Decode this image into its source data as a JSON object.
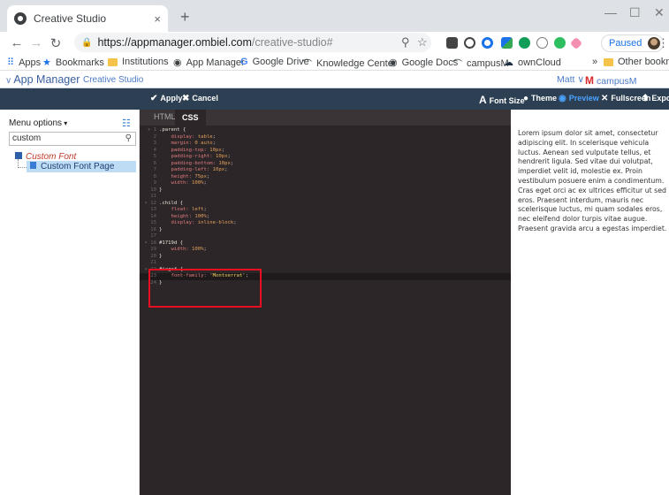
{
  "browser": {
    "tab_title": "Creative Studio",
    "tab_close": "×",
    "new_tab": "+",
    "url_host": "https://appmanager.ombiel.com",
    "url_path": "/creative-studio#",
    "paused_label": "Paused",
    "bookmarks": [
      {
        "label": "Apps"
      },
      {
        "label": "Bookmarks"
      },
      {
        "label": "Institutions"
      },
      {
        "label": "App Manager"
      },
      {
        "label": "Google Drive"
      },
      {
        "label": "Knowledge Center"
      },
      {
        "label": "Google Docs"
      },
      {
        "label": "campusM"
      },
      {
        "label": "ownCloud"
      }
    ],
    "more_bookmarks": "»",
    "other_bookmarks": "Other bookmarks"
  },
  "app": {
    "title": "App Manager",
    "subtitle": "Creative Studio",
    "user": "Matt",
    "org": "campusM University"
  },
  "toolbar": {
    "apply": "Apply",
    "cancel": "Cancel",
    "font_size": "Font Size",
    "theme": "Theme",
    "preview": "Preview",
    "fullscreen": "Fullscreen",
    "export": "Export"
  },
  "sidebar": {
    "menu_options": "Menu options",
    "search_value": "custom",
    "tree_root": "Custom Font",
    "tree_child": "Custom Font Page"
  },
  "editor": {
    "tabs": [
      "HTML",
      "CSS"
    ],
    "active_tab": "CSS"
  },
  "code_lines": [
    {
      "n": "1",
      "parts": [
        [
          "sel",
          ".parent {"
        ]
      ],
      "fold": true
    },
    {
      "n": "2",
      "parts": [
        [
          "prop",
          "    display: "
        ],
        [
          "val",
          "table"
        ],
        [
          "punc",
          ";"
        ]
      ]
    },
    {
      "n": "3",
      "parts": [
        [
          "prop",
          "    margin: "
        ],
        [
          "val",
          "0 auto"
        ],
        [
          "punc",
          ";"
        ]
      ]
    },
    {
      "n": "4",
      "parts": [
        [
          "prop",
          "    padding-top: "
        ],
        [
          "val",
          "10px"
        ],
        [
          "punc",
          ";"
        ]
      ]
    },
    {
      "n": "5",
      "parts": [
        [
          "prop",
          "    padding-right: "
        ],
        [
          "val",
          "10px"
        ],
        [
          "punc",
          ";"
        ]
      ]
    },
    {
      "n": "6",
      "parts": [
        [
          "prop",
          "    padding-bottom: "
        ],
        [
          "val",
          "10px"
        ],
        [
          "punc",
          ";"
        ]
      ]
    },
    {
      "n": "7",
      "parts": [
        [
          "prop",
          "    padding-left: "
        ],
        [
          "val",
          "10px"
        ],
        [
          "punc",
          ";"
        ]
      ]
    },
    {
      "n": "8",
      "parts": [
        [
          "prop",
          "    height: "
        ],
        [
          "val",
          "75px"
        ],
        [
          "punc",
          ";"
        ]
      ]
    },
    {
      "n": "9",
      "parts": [
        [
          "prop",
          "    width: "
        ],
        [
          "val",
          "100%"
        ],
        [
          "punc",
          ";"
        ]
      ]
    },
    {
      "n": "10",
      "parts": [
        [
          "sel",
          "}"
        ]
      ]
    },
    {
      "n": "11",
      "parts": []
    },
    {
      "n": "12",
      "parts": [
        [
          "sel",
          ".child {"
        ]
      ],
      "fold": true
    },
    {
      "n": "13",
      "parts": [
        [
          "prop",
          "    float: "
        ],
        [
          "val",
          "left"
        ],
        [
          "punc",
          ";"
        ]
      ]
    },
    {
      "n": "14",
      "parts": [
        [
          "prop",
          "    height: "
        ],
        [
          "val",
          "100%"
        ],
        [
          "punc",
          ";"
        ]
      ]
    },
    {
      "n": "15",
      "parts": [
        [
          "prop",
          "    display: "
        ],
        [
          "val",
          "inline-block"
        ],
        [
          "punc",
          ";"
        ]
      ]
    },
    {
      "n": "16",
      "parts": [
        [
          "sel",
          "}"
        ]
      ]
    },
    {
      "n": "17",
      "parts": []
    },
    {
      "n": "18",
      "parts": [
        [
          "sel",
          "#1719d {"
        ]
      ],
      "fold": true
    },
    {
      "n": "19",
      "parts": [
        [
          "prop",
          "    width: "
        ],
        [
          "val",
          "100%"
        ],
        [
          "punc",
          ";"
        ]
      ]
    },
    {
      "n": "20",
      "parts": [
        [
          "sel",
          "}"
        ]
      ]
    },
    {
      "n": "21",
      "parts": []
    },
    {
      "n": "22",
      "parts": [
        [
          "sel",
          "#iagof {"
        ]
      ],
      "fold": true
    },
    {
      "n": "23",
      "parts": [
        [
          "prop",
          "    font-family: "
        ],
        [
          "str",
          "'Montserrat'"
        ],
        [
          "punc",
          ";"
        ]
      ],
      "highlight": true
    },
    {
      "n": "24",
      "parts": [
        [
          "sel",
          "}"
        ]
      ]
    }
  ],
  "preview": {
    "text": "Lorem ipsum dolor sit amet, consectetur adipiscing elit. In scelerisque vehicula luctus. Aenean sed vulputate tellus, et hendrerit ligula. Sed vitae dui volutpat, imperdiet velit id, molestie ex. Proin vestibulum posuere enim a condimentum. Cras eget orci ac ex ultrices efficitur ut sed eros. Praesent interdum, mauris nec scelerisque luctus, mi quam sodales eros, nec eleifend dolor turpis vitae augue. Praesent gravida arcu a egestas imperdiet."
  },
  "colors": {
    "toolbar_bg": "#2d3f52",
    "editor_bg": "#2c2629",
    "highlight_box": "#e8101e",
    "link_blue": "#4a7bc8"
  }
}
